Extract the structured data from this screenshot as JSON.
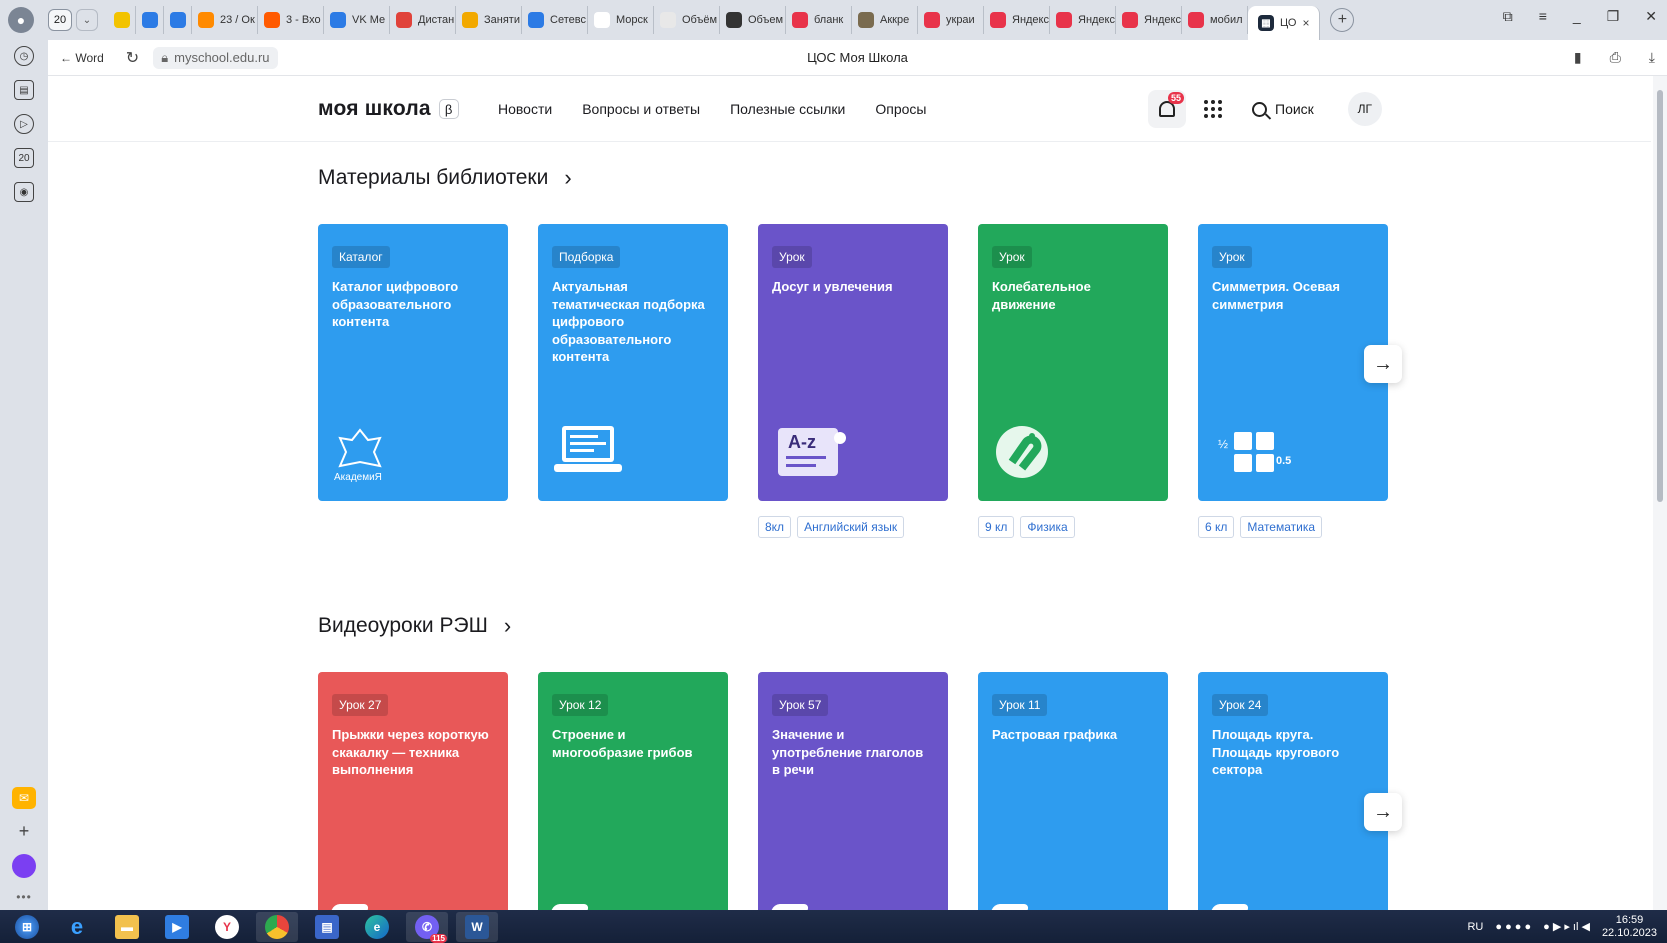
{
  "browser": {
    "tab_count": "20",
    "tabs": [
      {
        "label": "",
        "color": "#f2c300",
        "icon": "ukraine-flag-icon"
      },
      {
        "label": "",
        "color": "#2c7be5",
        "icon": "shield-icon"
      },
      {
        "label": "",
        "color": "#2c7be5",
        "icon": "chart-icon"
      },
      {
        "label": "23 / Ок",
        "color": "#ff8a00",
        "icon": "star-icon"
      },
      {
        "label": "3 - Вхо",
        "color": "#ff5a00",
        "icon": "mail-icon"
      },
      {
        "label": "VK Ме",
        "color": "#2c7be5",
        "icon": "vk-icon"
      },
      {
        "label": "Дистан",
        "color": "#e0423a",
        "icon": "calendar-icon"
      },
      {
        "label": "Заняти",
        "color": "#f2a900",
        "icon": "puzzle-icon"
      },
      {
        "label": "Сетевс",
        "color": "#2c7be5",
        "icon": "grid-icon"
      },
      {
        "label": "Морск",
        "color": "#ffffff",
        "icon": "document-icon"
      },
      {
        "label": "Объём",
        "color": "#e8e8e8",
        "icon": "loading-icon"
      },
      {
        "label": "Объем",
        "color": "#333333",
        "icon": "box-icon"
      },
      {
        "label": "бланк",
        "color": "#e8334a",
        "icon": "yandex-icon"
      },
      {
        "label": "Аккре",
        "color": "#7a6b4f",
        "icon": "emblem-icon"
      },
      {
        "label": "украи",
        "color": "#e8334a",
        "icon": "yandex-icon"
      },
      {
        "label": "Яндекс",
        "color": "#e8334a",
        "icon": "yandex-icon"
      },
      {
        "label": "Яндекс",
        "color": "#e8334a",
        "icon": "yandex-icon"
      },
      {
        "label": "Яндекс",
        "color": "#e8334a",
        "icon": "yandex-icon"
      },
      {
        "label": "мобил",
        "color": "#e8334a",
        "icon": "yandex-icon"
      }
    ],
    "active_tab": {
      "label": "ЦО",
      "close": "×"
    },
    "back_label": "← Word",
    "url": "myschool.edu.ru",
    "page_title": "ЦОС Моя Школа"
  },
  "site": {
    "logo": "моя школа",
    "beta": "β",
    "nav": [
      "Новости",
      "Вопросы и ответы",
      "Полезные ссылки",
      "Опросы"
    ],
    "notifications": "55",
    "search_label": "Поиск",
    "avatar": "ЛГ"
  },
  "library": {
    "title": "Материалы библиотеки",
    "cards": [
      {
        "tag": "Каталог",
        "title": "Каталог цифрового образовательного контента",
        "color": "#2e9cef",
        "illus": "academy-emblem-icon",
        "chips": []
      },
      {
        "tag": "Подборка",
        "title": "Актуальная тематическая подборка цифрового образовательного контента",
        "color": "#2e9cef",
        "illus": "laptop-icon",
        "chips": []
      },
      {
        "tag": "Урок",
        "title": "Досуг и увлечения",
        "color": "#6a54c9",
        "illus": "scroll-az-icon",
        "chips": [
          "8кл",
          "Английский язык"
        ]
      },
      {
        "tag": "Урок",
        "title": "Колебательное движение",
        "color": "#22a85b",
        "illus": "magnet-icon",
        "chips": [
          "9 кл",
          "Физика"
        ]
      },
      {
        "tag": "Урок",
        "title": "Симметрия. Осевая симметрия",
        "color": "#2e9cef",
        "illus": "math-blocks-icon",
        "chips": [
          "6 кл",
          "Математика"
        ]
      }
    ]
  },
  "videos": {
    "title": "Видеоуроки РЭШ",
    "cards": [
      {
        "tag": "Урок 27",
        "title": "Прыжки через короткую скакалку — техника выполнения",
        "color": "#e85858"
      },
      {
        "tag": "Урок 12",
        "title": "Строение и многообразие грибов",
        "color": "#22a85b"
      },
      {
        "tag": "Урок 57",
        "title": "Значение и употребление глаголов в речи",
        "color": "#6a54c9"
      },
      {
        "tag": "Урок 11",
        "title": "Растровая графика",
        "color": "#2e9cef"
      },
      {
        "tag": "Урок 24",
        "title": "Площадь круга. Площадь кругового сектора",
        "color": "#2e9cef"
      }
    ]
  },
  "taskbar": {
    "viber_badge": "115",
    "lang": "RU",
    "time": "16:59",
    "date": "22.10.2023"
  }
}
